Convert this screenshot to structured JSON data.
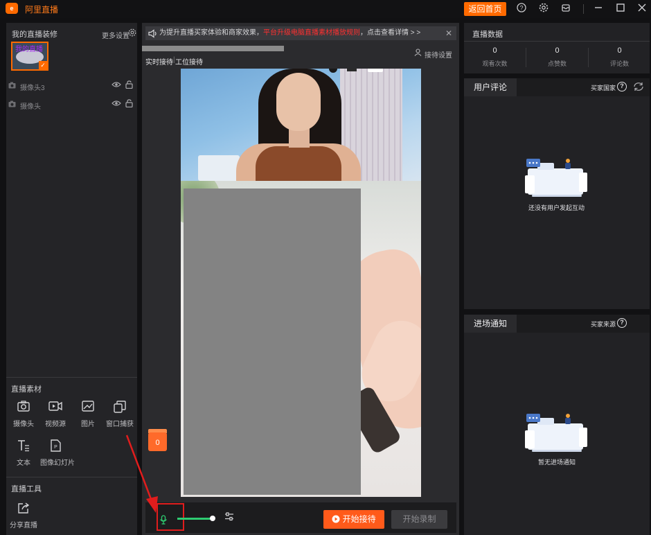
{
  "app": {
    "title": "阿里直播",
    "logo_text": "e"
  },
  "titlebar": {
    "return_home_label": "返回首页",
    "icons": [
      "help-icon",
      "settings-icon",
      "mailbox-icon",
      "minimize-icon",
      "maximize-icon",
      "close-icon"
    ]
  },
  "left": {
    "decor_title": "我的直播装修",
    "more_settings": "更多设置",
    "thumb_text": "我的直播",
    "sources": [
      {
        "label": "摄像头3"
      },
      {
        "label": "摄像头"
      }
    ],
    "materials_title": "直播素材",
    "materials": [
      {
        "label": "摄像头",
        "icon": "camera-icon"
      },
      {
        "label": "视频源",
        "icon": "video-source-icon"
      },
      {
        "label": "图片",
        "icon": "image-icon"
      },
      {
        "label": "窗口捕获",
        "icon": "window-capture-icon"
      },
      {
        "label": "文本",
        "icon": "text-icon"
      },
      {
        "label": "图像幻灯片",
        "icon": "slideshow-icon"
      }
    ],
    "tools_title": "直播工具",
    "tools": [
      {
        "label": "分享直播",
        "icon": "share-icon"
      }
    ]
  },
  "center": {
    "notice": {
      "prefix": "为提升直播买家体验和商家效果，",
      "highlight": "平台升级电脑直播素材播放规则",
      "suffix": "，点击查看详情 > >"
    },
    "tabs": {
      "realtime": "实时接待",
      "separator": "|",
      "station": "工位接待"
    },
    "reception_settings": "接待设置",
    "gift_count": "0",
    "start_reception": "开始接待",
    "start_record": "开始录制",
    "volume_level": 0.9
  },
  "right": {
    "stats_title": "直播数据",
    "stats": [
      {
        "value": "0",
        "label": "观看次数"
      },
      {
        "value": "0",
        "label": "点赞数"
      },
      {
        "value": "0",
        "label": "评论数"
      }
    ],
    "comments": {
      "title": "用户评论",
      "buyer_country": "买家国家",
      "empty": "还没有用户发起互动"
    },
    "entry": {
      "title": "进场通知",
      "buyer_source": "买家来源",
      "empty": "暂无进场通知"
    }
  },
  "colors": {
    "accent": "#ff6a00",
    "mic_green": "#2ecc71",
    "highlight_red": "#ff3030",
    "annotation_red": "#e01d1d"
  }
}
